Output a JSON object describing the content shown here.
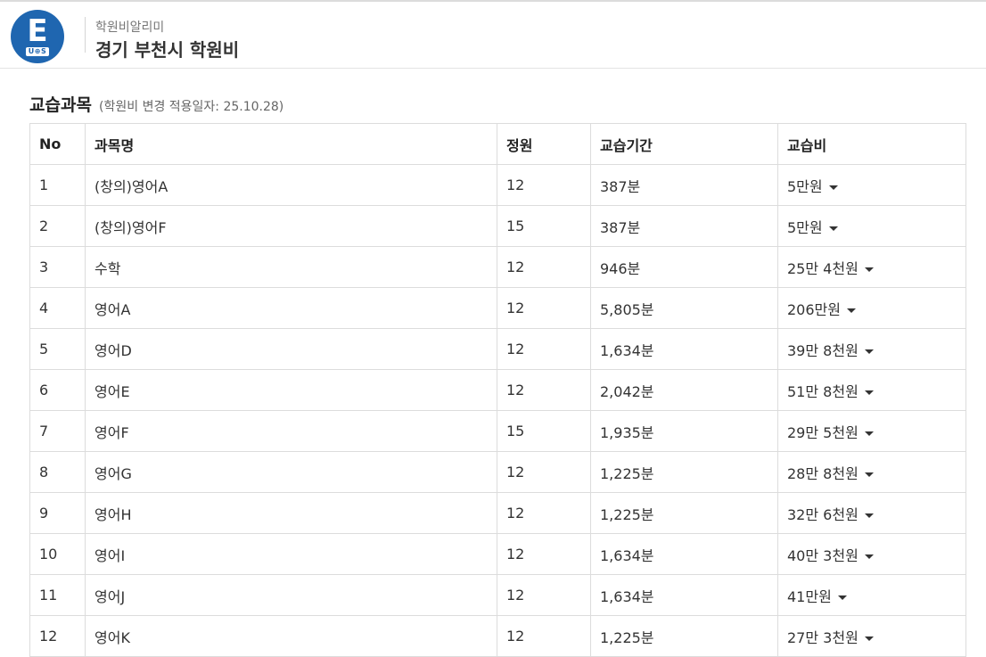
{
  "header": {
    "logo_letter": "E",
    "logo_sub": "U⊕S",
    "subtitle": "학원비알리미",
    "title": "경기 부천시 학원비"
  },
  "section": {
    "title": "교습과목",
    "note": "(학원비 변경 적용일자: 25.10.28)"
  },
  "table": {
    "headers": [
      "No",
      "과목명",
      "정원",
      "교습기간",
      "교습비"
    ],
    "rows": [
      {
        "no": "1",
        "subject": "(창의)영어A",
        "capacity": "12",
        "period": "387분",
        "fee": "5만원"
      },
      {
        "no": "2",
        "subject": "(창의)영어F",
        "capacity": "15",
        "period": "387분",
        "fee": "5만원"
      },
      {
        "no": "3",
        "subject": "수학",
        "capacity": "12",
        "period": "946분",
        "fee": "25만 4천원"
      },
      {
        "no": "4",
        "subject": "영어A",
        "capacity": "12",
        "period": "5,805분",
        "fee": "206만원"
      },
      {
        "no": "5",
        "subject": "영어D",
        "capacity": "12",
        "period": "1,634분",
        "fee": "39만 8천원"
      },
      {
        "no": "6",
        "subject": "영어E",
        "capacity": "12",
        "period": "2,042분",
        "fee": "51만 8천원"
      },
      {
        "no": "7",
        "subject": "영어F",
        "capacity": "15",
        "period": "1,935분",
        "fee": "29만 5천원"
      },
      {
        "no": "8",
        "subject": "영어G",
        "capacity": "12",
        "period": "1,225분",
        "fee": "28만 8천원"
      },
      {
        "no": "9",
        "subject": "영어H",
        "capacity": "12",
        "period": "1,225분",
        "fee": "32만 6천원"
      },
      {
        "no": "10",
        "subject": "영어I",
        "capacity": "12",
        "period": "1,634분",
        "fee": "40만 3천원"
      },
      {
        "no": "11",
        "subject": "영어J",
        "capacity": "12",
        "period": "1,634분",
        "fee": "41만원"
      },
      {
        "no": "12",
        "subject": "영어K",
        "capacity": "12",
        "period": "1,225분",
        "fee": "27만 3천원"
      }
    ]
  },
  "icons": {
    "fee_expand": "caret-down-icon"
  },
  "colors": {
    "brand": "#1f66b0"
  }
}
